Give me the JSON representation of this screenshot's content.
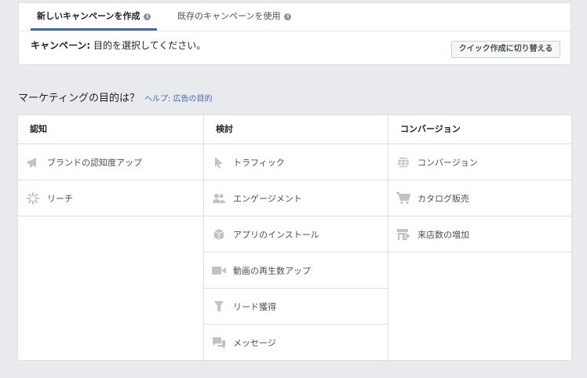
{
  "tabs": [
    {
      "label": "新しいキャンペーンを作成",
      "active": true
    },
    {
      "label": "既存のキャンペーンを使用",
      "active": false
    }
  ],
  "campaign": {
    "label": "キャンペーン:",
    "text": "目的を選択してください。",
    "quick_button": "クイック作成に切り替える"
  },
  "question": {
    "text": "マーケティングの目的は？",
    "help": "ヘルプ: 広告の目的"
  },
  "columns": [
    {
      "header": "認知",
      "items": [
        {
          "label": "ブランドの認知度アップ",
          "icon": "megaphone-icon"
        },
        {
          "label": "リーチ",
          "icon": "reach-icon"
        }
      ]
    },
    {
      "header": "検討",
      "items": [
        {
          "label": "トラフィック",
          "icon": "cursor-icon"
        },
        {
          "label": "エンゲージメント",
          "icon": "people-icon"
        },
        {
          "label": "アプリのインストール",
          "icon": "box-icon"
        },
        {
          "label": "動画の再生数アップ",
          "icon": "video-camera-icon"
        },
        {
          "label": "リード獲得",
          "icon": "funnel-icon"
        },
        {
          "label": "メッセージ",
          "icon": "chat-bubbles-icon"
        }
      ]
    },
    {
      "header": "コンバージョン",
      "items": [
        {
          "label": "コンバージョン",
          "icon": "globe-icon"
        },
        {
          "label": "カタログ販売",
          "icon": "shopping-cart-icon"
        },
        {
          "label": "来店数の増加",
          "icon": "store-icon"
        }
      ]
    }
  ],
  "colors": {
    "accent": "#4267b2",
    "icon": "#bec3c9"
  }
}
